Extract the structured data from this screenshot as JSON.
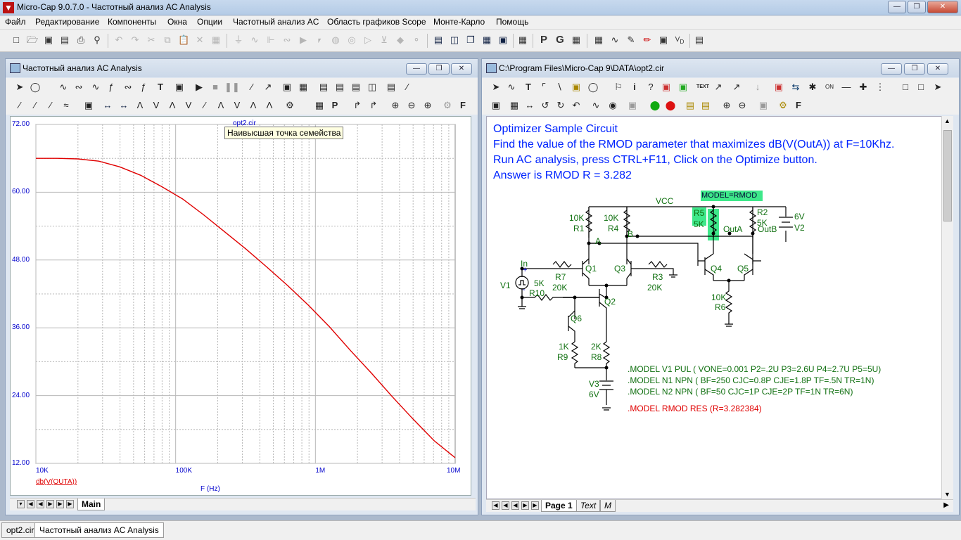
{
  "window": {
    "title": "Micro-Cap 9.0.7.0 - Частотный анализ AC Analysis",
    "app_icon": "micro-cap-icon"
  },
  "menu": [
    "Файл",
    "Редактирование",
    "Компоненты",
    "Окна",
    "Опции",
    "Частотный анализ AC",
    "Область графиков Scope",
    "Монте-Карло",
    "Помощь"
  ],
  "left_window": {
    "title": "Частотный анализ AC Analysis",
    "plot": {
      "file_label": "opt2.cir",
      "tooltip": "Наивысшая точка семейства",
      "y_ticks": [
        "72.00",
        "60.00",
        "48.00",
        "36.00",
        "24.00",
        "12.00"
      ],
      "x_ticks": [
        "10K",
        "100K",
        "1M",
        "10M"
      ],
      "trace_label": "db(V(OUTA))",
      "x_axis_label": "F (Hz)",
      "trace_color": "#e00000"
    },
    "tab": "Main"
  },
  "right_window": {
    "title": "C:\\Program Files\\Micro-Cap 9\\DATA\\opt2.cir",
    "text_lines": [
      "Optimizer Sample Circuit",
      "Find the value of the RMOD parameter that maximizes dB(V(OutA)) at F=10Khz.",
      "Run AC analysis, press CTRL+F11, Click on the Optimize button.",
      "Answer is RMOD R = 3.282"
    ],
    "models": [
      ".MODEL V1 PUL ( VONE=0.001 P2=.2U P3=2.6U P4=2.7U P5=5U)",
      ".MODEL N1 NPN ( BF=250 CJC=0.8P CJE=1.8P TF=.5N TR=1N)",
      ".MODEL N2 NPN ( BF=50 CJC=1P CJE=2P TF=1N TR=6N)"
    ],
    "rmod_model": ".MODEL RMOD RES (R=3.282384)",
    "schematic_labels": {
      "model_rmod": "MODEL=RMOD",
      "vcc": "VCC",
      "r1_val": "10K",
      "r1": "R1",
      "r4_val": "10K",
      "r4": "R4",
      "r5": "R5",
      "r5_val": "5K",
      "r2": "R2",
      "r2_val": "5K",
      "v2_val": "6V",
      "v2": "V2",
      "outa": "OutA",
      "outb": "OutB",
      "a": "A",
      "b": "B",
      "in": "In",
      "plus": "+",
      "minus": "-",
      "q1": "Q1",
      "q3": "Q3",
      "q4": "Q4",
      "q5": "Q5",
      "q2": "Q2",
      "q6": "Q6",
      "r7": "R7",
      "r7_val": "20K",
      "r3": "R3",
      "r3_val": "20K",
      "v1": "V1",
      "r10_val": "5K",
      "r10": "R10",
      "r6_val": "10K",
      "r6": "R6",
      "r9_val": "1K",
      "r9": "R9",
      "r8_val": "2K",
      "r8": "R8",
      "v3": "V3",
      "v3_val": "6V"
    },
    "tabs": [
      "Page 1",
      "Text",
      "M"
    ]
  },
  "taskbar_tabs": [
    "opt2.cir",
    "Частотный анализ AC Analysis"
  ],
  "colors": {
    "schematic_text": "#0024ff",
    "component_labels": "#107010",
    "rmod": "#e00000",
    "highlight": "#3ee88a"
  }
}
